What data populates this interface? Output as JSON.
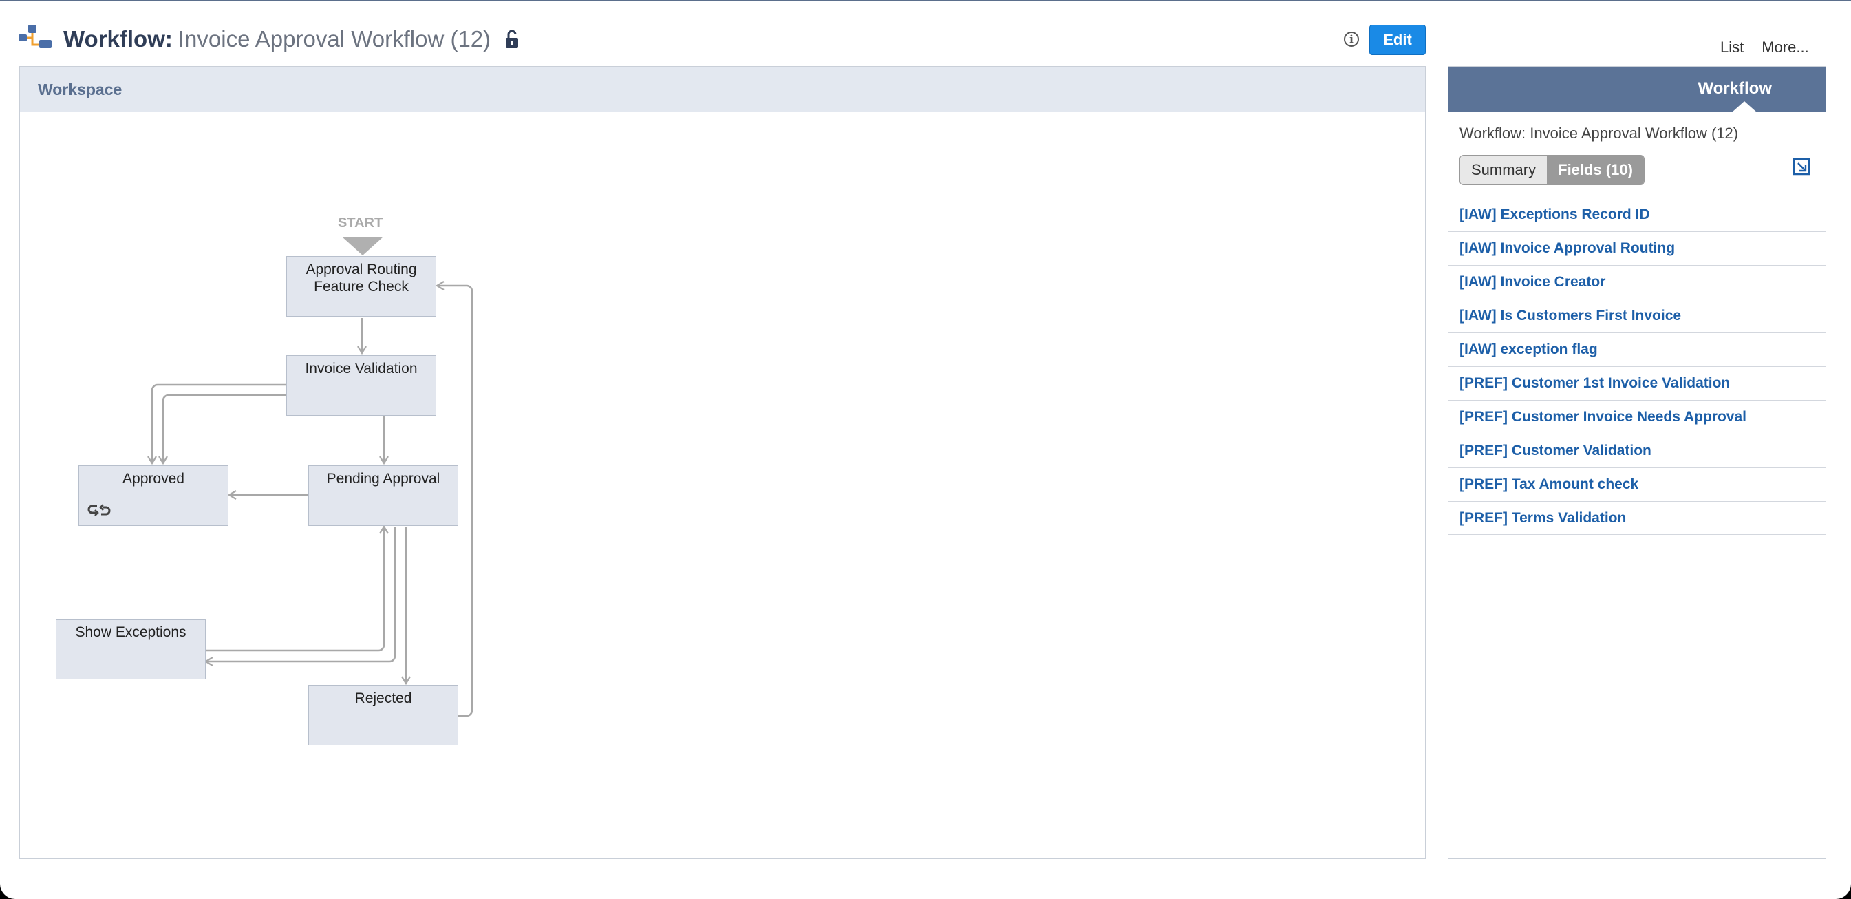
{
  "header": {
    "title_label": "Workflow:",
    "title_value": "Invoice Approval Workflow (12)",
    "edit_label": "Edit"
  },
  "top_links": [
    "List",
    "More..."
  ],
  "workspace": {
    "title": "Workspace",
    "start_label": "START",
    "nodes": {
      "approval_routing": "Approval Routing\nFeature Check",
      "invoice_validation": "Invoice Validation",
      "approved": "Approved",
      "pending_approval": "Pending Approval",
      "show_exceptions": "Show Exceptions",
      "rejected": "Rejected"
    }
  },
  "side_panel": {
    "tab": "Workflow",
    "subtitle": "Workflow: Invoice Approval Workflow (12)",
    "segments": {
      "summary": "Summary",
      "fields": "Fields (10)"
    },
    "fields": [
      "[IAW] Exceptions Record ID",
      "[IAW] Invoice Approval Routing",
      "[IAW] Invoice Creator",
      "[IAW] Is Customers First Invoice",
      "[IAW] exception flag",
      "[PREF] Customer 1st Invoice Validation",
      "[PREF] Customer Invoice Needs Approval",
      "[PREF] Customer Validation",
      "[PREF] Tax Amount check",
      "[PREF] Terms Validation"
    ]
  },
  "colors": {
    "accent": "#1a8ae6",
    "panel_header": "#5b7397",
    "node_fill": "#e2e6ee",
    "link": "#1d5fa8"
  }
}
